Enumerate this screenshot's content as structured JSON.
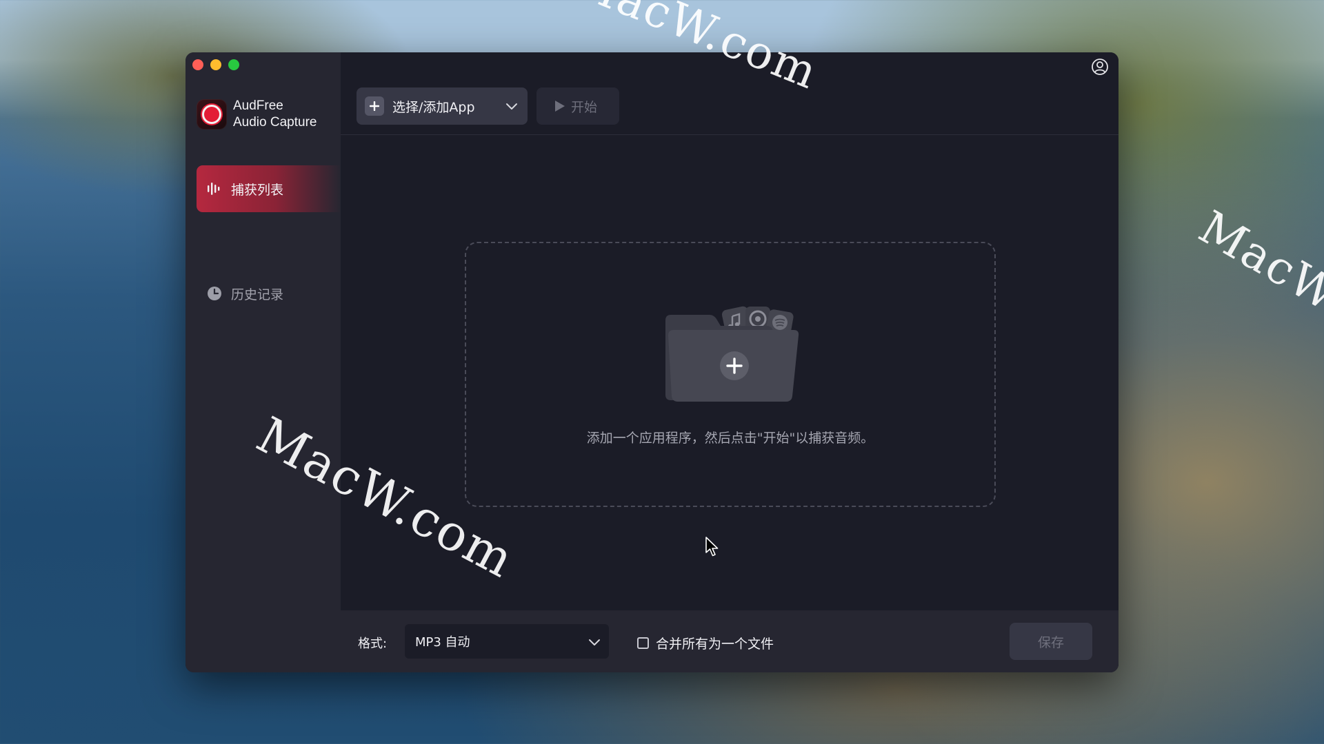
{
  "watermark": "MacW.com",
  "app": {
    "name_line1": "AudFree",
    "name_line2": "Audio Capture"
  },
  "sidebar": {
    "items": [
      {
        "label": "捕获列表",
        "icon": "waveform-icon",
        "active": true
      },
      {
        "label": "历史记录",
        "icon": "clock-icon",
        "active": false
      }
    ]
  },
  "toolbar": {
    "select_app_label": "选择/添加App",
    "start_label": "开始"
  },
  "dropzone": {
    "hint": "添加一个应用程序，然后点击\"开始\"以捕获音频。"
  },
  "bottom": {
    "format_label": "格式:",
    "format_value": "MP3 自动",
    "merge_label": "合并所有为一个文件",
    "merge_checked": false,
    "save_label": "保存"
  },
  "colors": {
    "accent": "#b5283f",
    "window_bg": "#1b1c27",
    "sidebar_bg": "#262631"
  }
}
